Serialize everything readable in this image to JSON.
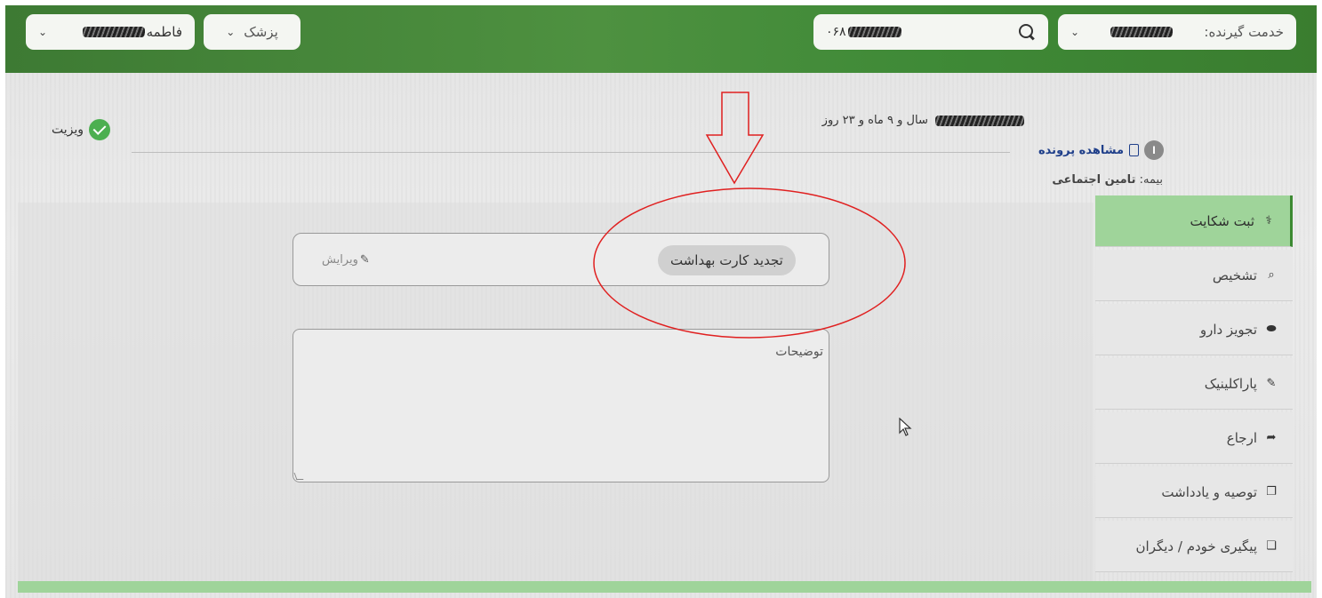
{
  "topbar": {
    "provider_label": "خدمت گیرنده:",
    "search_value": "۰۶۸",
    "doctor_label": "پزشک",
    "user_label": "فاطمه"
  },
  "patient": {
    "age_text": "سال و ۹ ماه و ۲۳ روز",
    "badge": "ا",
    "view_file_label": "مشاهده پرونده",
    "insurance_label": "بیمه:",
    "insurance_value": "تامین اجتماعی"
  },
  "visit": {
    "label": "ویزیت"
  },
  "sidebar": {
    "items": [
      {
        "label": "ثبت شکایت",
        "icon": "stethoscope-icon",
        "glyph": "⚕"
      },
      {
        "label": "تشخیص",
        "icon": "diagnosis-search-icon",
        "glyph": "⌕"
      },
      {
        "label": "تجویز دارو",
        "icon": "pill-icon",
        "glyph": "⬬"
      },
      {
        "label": "پاراکلینیک",
        "icon": "syringe-icon",
        "glyph": "✎"
      },
      {
        "label": "ارجاع",
        "icon": "share-icon",
        "glyph": "➦"
      },
      {
        "label": "توصیه و یادداشت",
        "icon": "note-add-icon",
        "glyph": "❐"
      },
      {
        "label": "پیگیری خودم / دیگران",
        "icon": "followup-icon",
        "glyph": "❏"
      }
    ]
  },
  "complaint": {
    "tag": "تجدید کارت بهداشت",
    "edit_label": "ویرایش"
  },
  "notes": {
    "label": "توضیحات"
  },
  "colors": {
    "topbar": "#4e9140",
    "active_menu": "#9fd49a",
    "annotation": "#e02020"
  }
}
